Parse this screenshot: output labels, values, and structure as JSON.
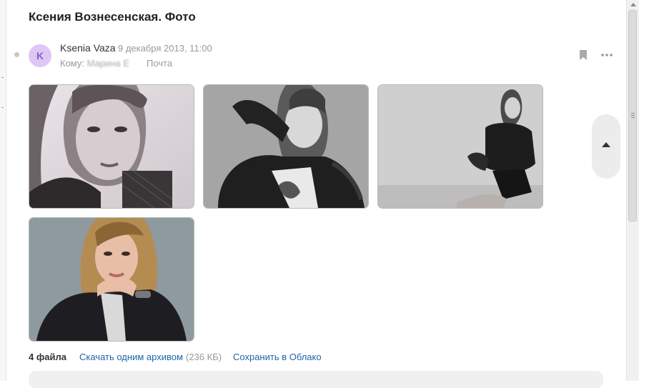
{
  "message": {
    "subject": "Ксения Вознесенская. Фото",
    "sender": {
      "initial": "K",
      "name": "Ksenia Vaza",
      "avatar_color": "#dcc7f5"
    },
    "date": "9 декабря 2013, 11:00",
    "to_label": "Кому:",
    "to_recipient": "Марина Е",
    "folder": "Почта"
  },
  "toolbar": {
    "bookmark_icon": "bookmark-icon",
    "more_icon": "more-dots-icon"
  },
  "attachments": {
    "count_label": "4 файла",
    "download_all_label": "Скачать одним архивом",
    "archive_size": "(236 КБ)",
    "save_cloud_label": "Сохранить в Облако",
    "link_color": "#1f64a8"
  },
  "navigation": {
    "scroll_top_icon": "arrow-up-icon"
  }
}
